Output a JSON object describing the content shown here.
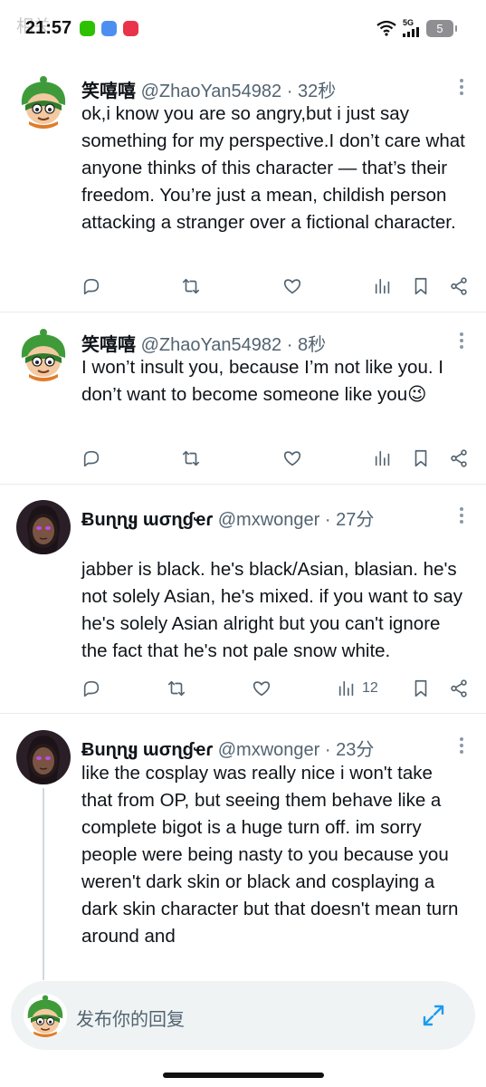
{
  "status_bar": {
    "ghost_text": "相关",
    "time": "21:57",
    "network": "5G",
    "battery": "5",
    "app_icons": [
      "wechat-icon",
      "weather-icon",
      "browser-icon"
    ]
  },
  "tweets": [
    {
      "name": "笑嘻嘻",
      "handle": "@ZhaoYan54982",
      "separator": "·",
      "time": "32秒",
      "text": "ok,i know you are so angry,but i  just say something for my perspective.I don’t care what anyone thinks of this character — that’s their freedom. You’re just a mean, childish person attacking a stranger over a fictional character.",
      "views": "",
      "avatar": "green-hat-cartoon-avatar"
    },
    {
      "name": "笑嘻嘻",
      "handle": "@ZhaoYan54982",
      "separator": "·",
      "time": "8秒",
      "text": "I won’t insult you, because I’m not like you. I don’t want to become someone like you😉",
      "views": "",
      "avatar": "green-hat-cartoon-avatar"
    },
    {
      "name": "Ƀuɳɳყ ɯσɳɠҽɾ",
      "handle": "@mxwonger",
      "separator": "·",
      "time": "27分",
      "text": "jabber is black. he's black/Asian, blasian. he's not solely Asian, he's mixed. if you want to say he's solely Asian alright but you can't ignore the fact that he's not pale snow white.",
      "views": "12",
      "avatar": "dark-character-avatar"
    },
    {
      "name": "Ƀuɳɳყ ɯσɳɠҽɾ",
      "handle": "@mxwonger",
      "separator": "·",
      "time": "23分",
      "text": "like the cosplay was really nice i won't take that from OP, but seeing them behave like a complete bigot is a huge turn off. im sorry people were being nasty to you because you weren't dark skin or black and cosplaying a dark skin character but that doesn't mean turn around and",
      "views": "",
      "avatar": "dark-character-avatar"
    }
  ],
  "reply_bar": {
    "placeholder": "发布你的回复"
  },
  "colors": {
    "text_primary": "#0f1419",
    "text_secondary": "#536471",
    "divider": "#e6ecf0",
    "reply_bg": "#eff3f4"
  }
}
